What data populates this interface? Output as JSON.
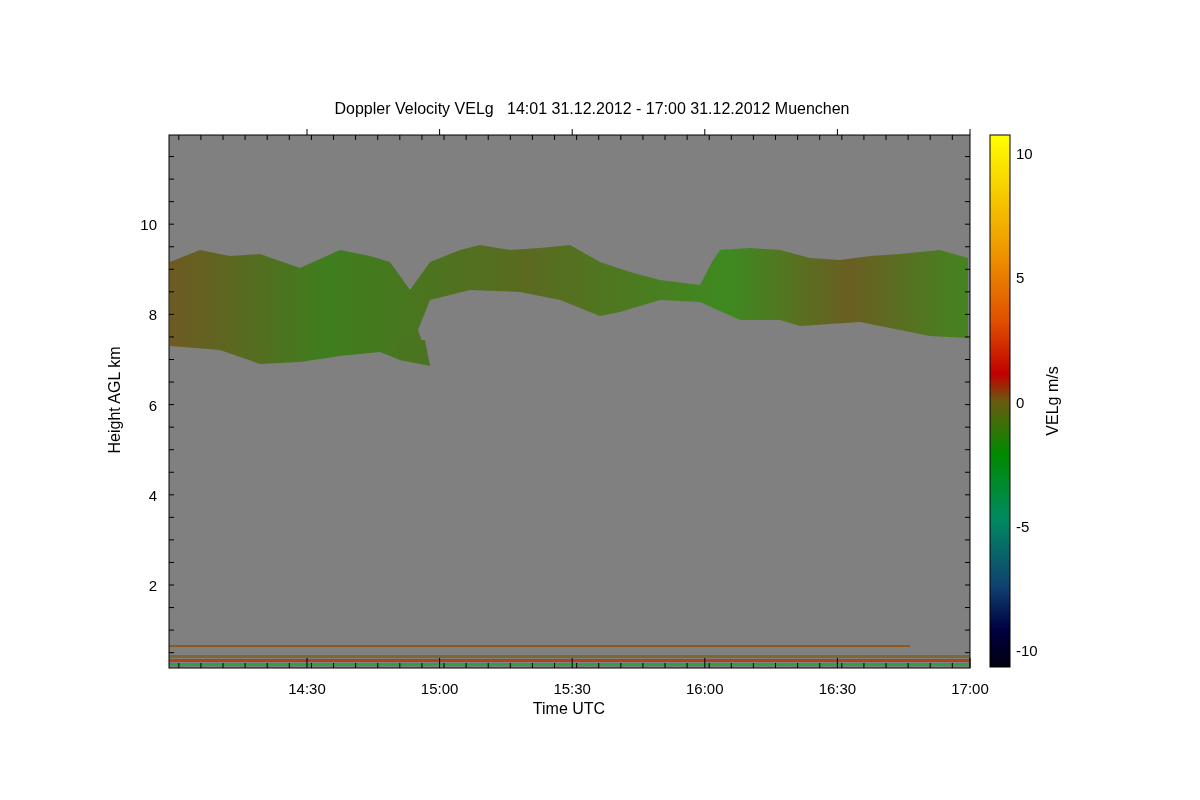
{
  "title": "Doppler Velocity VELg   14:01 31.12.2012 - 17:00 31.12.2012 Muenchen",
  "y_axis": {
    "label": "Height AGL km",
    "ticks": [
      "10",
      "8",
      "6",
      "4",
      "2"
    ]
  },
  "x_axis": {
    "label": "Time UTC",
    "ticks": [
      "14:30",
      "15:00",
      "15:30",
      "16:00",
      "16:30",
      "17:00"
    ]
  },
  "colorbar": {
    "label": "VELg m/s",
    "ticks": [
      "10",
      "5",
      "0",
      "-5",
      "-10"
    ]
  }
}
